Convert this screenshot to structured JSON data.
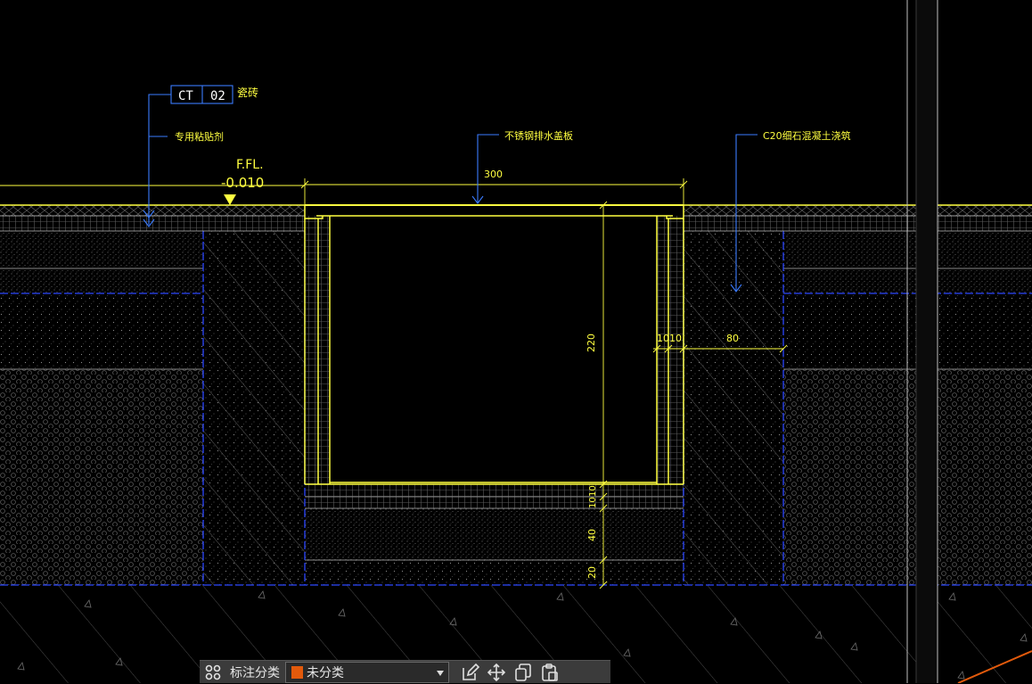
{
  "drawing": {
    "tile_tag": {
      "code": "CT",
      "number": "02",
      "material": "瓷砖"
    },
    "callouts": {
      "adhesive": "专用粘贴剂",
      "grate": "不锈钢排水盖板",
      "concrete": "C20细石混凝土浇筑"
    },
    "level": {
      "label": "F.FL.",
      "value": "-0.010"
    },
    "dimensions": {
      "width": "300",
      "depth": "220",
      "wall_left": "10",
      "wall_right": "10",
      "wall_thickness": "80",
      "bottom_1": "10",
      "bottom_2": "10",
      "bottom_3": "40",
      "bottom_4": "20"
    },
    "colors": {
      "background": "#000000",
      "drawing_line": "#ffff40",
      "leader_blue": "#3a7bff",
      "text_yellow": "#ffff40",
      "text_white": "#ffffff",
      "hatch_gray": "#6e6e6e"
    }
  },
  "toolbar": {
    "grid_icon": "grid-icon",
    "label": "标注分类",
    "category": {
      "value": "未分类",
      "swatch": "#e25a0c"
    },
    "tools": [
      "edit-icon",
      "move-icon",
      "copy-icon",
      "paste-icon"
    ]
  }
}
